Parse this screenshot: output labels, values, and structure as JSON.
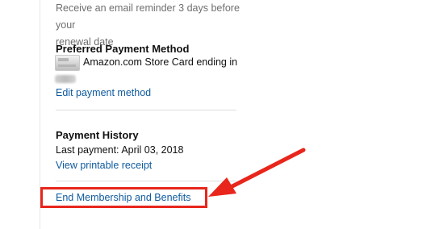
{
  "renewal": {
    "reminder_line1": "Receive an email reminder 3 days before your",
    "reminder_line2": "renewal date"
  },
  "payment_method": {
    "heading": "Preferred Payment Method",
    "card_text": "Amazon.com Store Card ending in",
    "card_icon": "store-card-icon",
    "edit_link": "Edit payment method"
  },
  "payment_history": {
    "heading": "Payment History",
    "last_payment_label": "Last payment:",
    "last_payment_date": "April 03, 2018",
    "receipt_link": "View printable receipt"
  },
  "end_membership": {
    "link": "End Membership and Benefits"
  },
  "annotation": {
    "color": "#e8261c"
  },
  "colors": {
    "link": "#0e5a9f",
    "muted_text": "#6f6f6f"
  }
}
